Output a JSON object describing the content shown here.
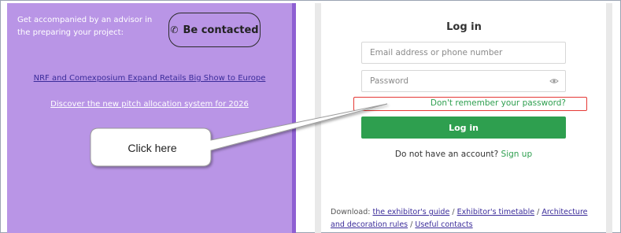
{
  "left_panel": {
    "advisor_text": "Get accompanied by an advisor in the preparing your project:",
    "contact_button": {
      "icon": "phone-icon",
      "glyph": "✆",
      "label": "Be contacted"
    },
    "news_link_1": "NRF and Comexposium Expand Retails Big Show to Europe",
    "news_link_2": "Discover the new pitch allocation system for 2026"
  },
  "callout": {
    "text": "Click here"
  },
  "login": {
    "title": "Log in",
    "email_placeholder": "Email address or phone number",
    "password_placeholder": "Password",
    "forgot_link": "Don't remember your password?",
    "button": "Log in",
    "no_account_text": "Do not have an account?",
    "signup_link": "Sign up"
  },
  "downloads": {
    "prefix": "Download:",
    "links": [
      "the exhibitor's guide",
      "Exhibitor's timetable",
      "Architecture and decoration rules",
      "Useful contacts"
    ],
    "separator": " / "
  },
  "colors": {
    "purple_panel": "#b995e6",
    "green": "#2e9f4f",
    "highlight_red": "#e53935"
  }
}
